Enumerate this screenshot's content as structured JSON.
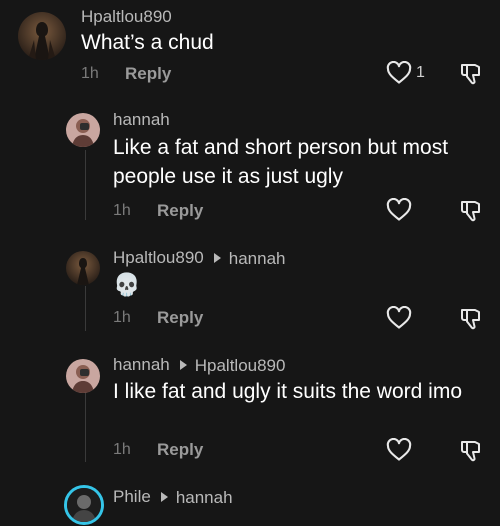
{
  "comments": [
    {
      "username": "Hpaltlou890",
      "reply_to": "",
      "text": "What’s a chud",
      "time": "1h",
      "reply_label": "Reply",
      "likes": "1"
    },
    {
      "username": "hannah",
      "reply_to": "",
      "text": "Like a fat and short person but most people use it as just ugly",
      "time": "1h",
      "reply_label": "Reply",
      "likes": ""
    },
    {
      "username": "Hpaltlou890",
      "reply_to": "hannah",
      "text": "💀",
      "time": "1h",
      "reply_label": "Reply",
      "likes": ""
    },
    {
      "username": "hannah",
      "reply_to": "Hpaltlou890",
      "text": "I like fat and ugly it suits the word imo",
      "time": "1h",
      "reply_label": "Reply",
      "likes": ""
    },
    {
      "username": "Phile",
      "reply_to": "hannah",
      "text": "",
      "time": "",
      "reply_label": "",
      "likes": ""
    }
  ],
  "icons": {
    "like": "heart-icon",
    "dislike": "thumbs-down-icon",
    "reply_arrow": "caret-right-icon"
  },
  "colors": {
    "background": "#161616",
    "username": "#b9b9b9",
    "text": "#ffffff",
    "muted": "#7a7a7a"
  }
}
